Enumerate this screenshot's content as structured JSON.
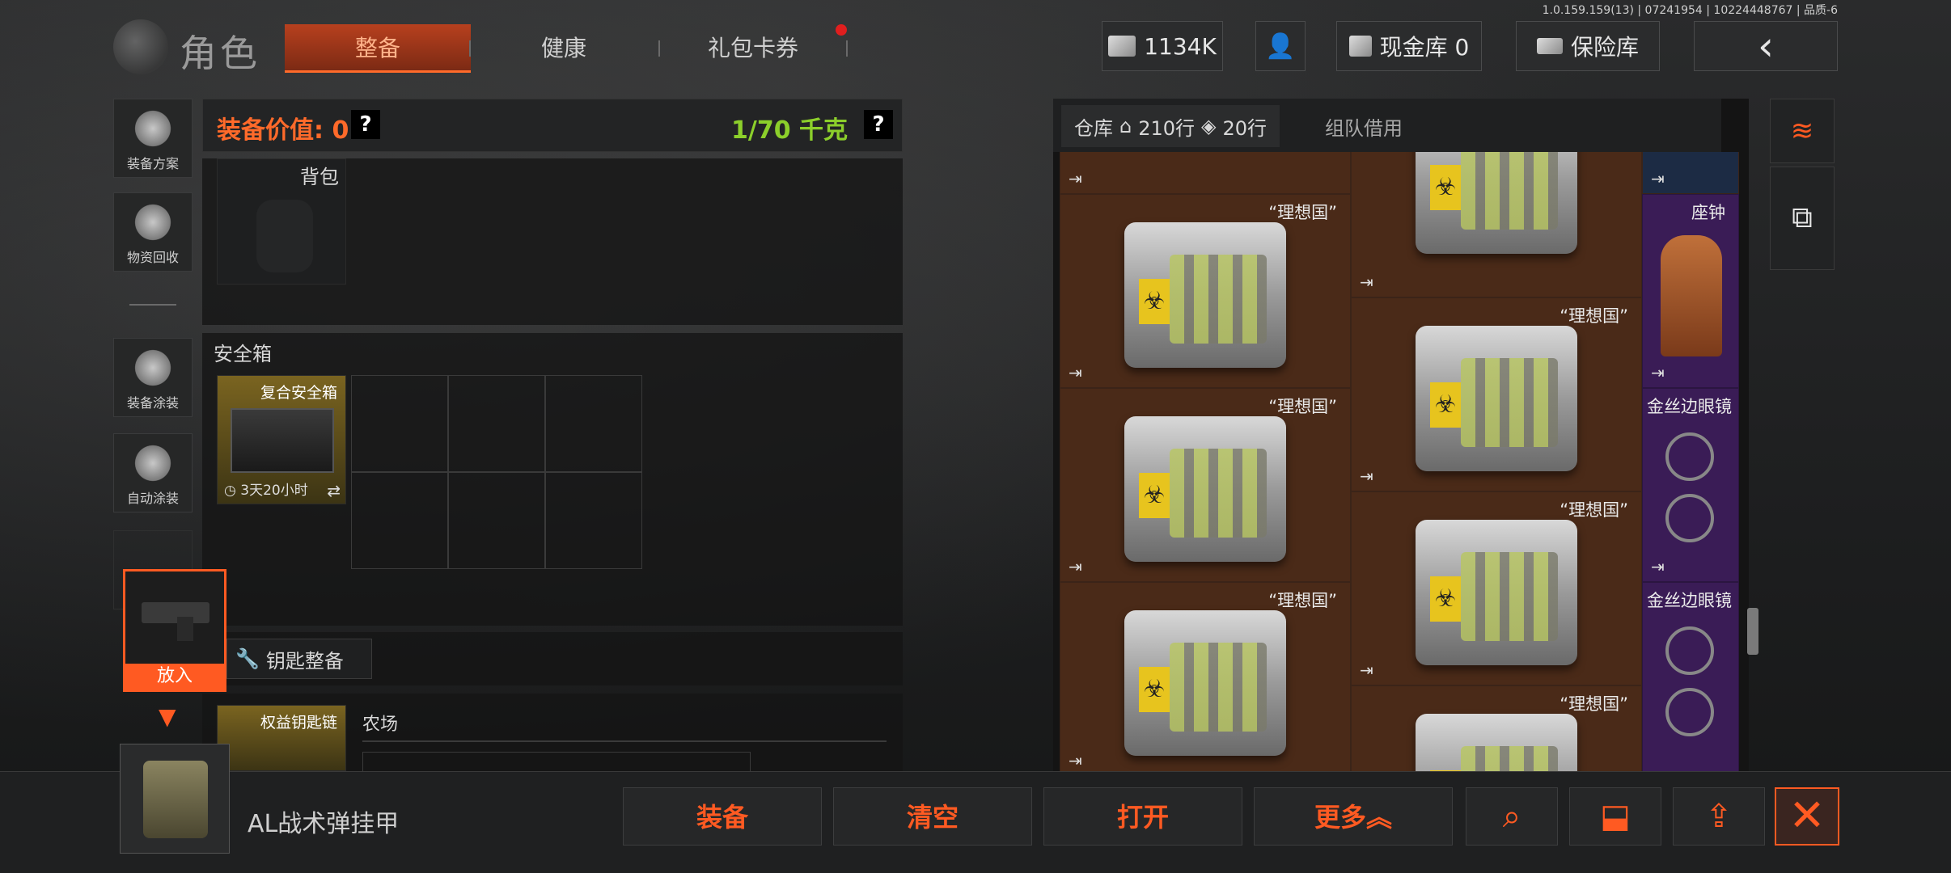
{
  "version": "1.0.159.159(13) | 07241954 | 10224448767 | 品质-6",
  "header": {
    "title": "角色",
    "tabs": [
      {
        "label": "整备",
        "active": true
      },
      {
        "label": "健康",
        "active": false
      },
      {
        "label": "礼包卡券",
        "active": false
      }
    ],
    "money": "1134K",
    "cash_vault": "现金库 0",
    "insurance": "保险库"
  },
  "sidebar": [
    {
      "label": "装备方案"
    },
    {
      "label": "物资回收"
    },
    {
      "label": "装备涂装"
    },
    {
      "label": "自动涂装"
    }
  ],
  "equipment": {
    "value_label": "装备价值: 0",
    "weight": "1/70 千克",
    "help": "?",
    "backpack_title": "背包",
    "safe_box_title": "安全箱",
    "safe_box_item": "复合安全箱",
    "safe_box_timer": "3天20小时",
    "key_title": "钥匙整备",
    "key_item": "权益钥匙链",
    "farm_label": "农场",
    "drag_put_label": "放入"
  },
  "warehouse": {
    "tab_label": "仓库",
    "rows_1": "210行",
    "rows_2": "20行",
    "team_borrow": "组队借用",
    "items": [
      {
        "name": "",
        "color": "brown"
      },
      {
        "name": "",
        "color": "brown"
      },
      {
        "name": "",
        "color": "blue"
      },
      {
        "name": "“理想国”",
        "color": "brown"
      },
      {
        "name": "座钟",
        "color": "purple"
      },
      {
        "name": "“理想国”",
        "color": "brown"
      },
      {
        "name": "“理想国”",
        "color": "brown"
      },
      {
        "name": "金丝边眼镜",
        "color": "purple"
      },
      {
        "name": "“理想国”",
        "color": "brown"
      },
      {
        "name": "“理想国”",
        "color": "brown"
      },
      {
        "name": "金丝边眼镜",
        "color": "purple"
      },
      {
        "name": "“理想国”",
        "color": "brown"
      }
    ]
  },
  "bottom": {
    "selected_item": "AL战术弹挂甲",
    "buttons": [
      "装备",
      "清空",
      "打开",
      "更多"
    ]
  }
}
